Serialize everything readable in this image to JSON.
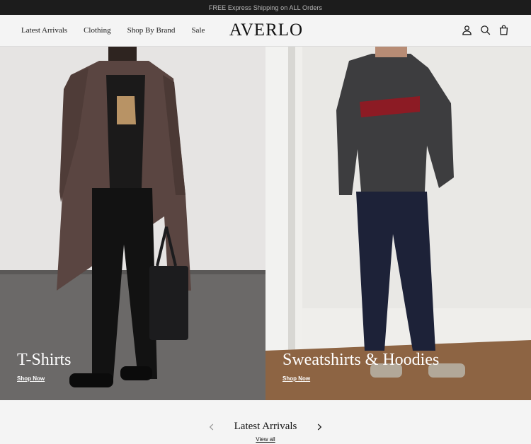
{
  "announcement": "FREE Express Shipping on ALL Orders",
  "header": {
    "nav": [
      "Latest Arrivals",
      "Clothing",
      "Shop By Brand",
      "Sale"
    ],
    "logo": "AVERLO",
    "icons": [
      "account-icon",
      "search-icon",
      "cart-icon"
    ]
  },
  "hero": {
    "panels": [
      {
        "title": "T-Shirts",
        "cta": "Shop Now"
      },
      {
        "title": "Sweatshirts & Hoodies",
        "cta": "Shop Now"
      }
    ]
  },
  "arrivals": {
    "title": "Latest Arrivals",
    "view_all": "View all"
  },
  "colors": {
    "announcement_bg": "#1c1c1c",
    "page_bg": "#f4f4f4",
    "text": "#1a1a1a"
  }
}
